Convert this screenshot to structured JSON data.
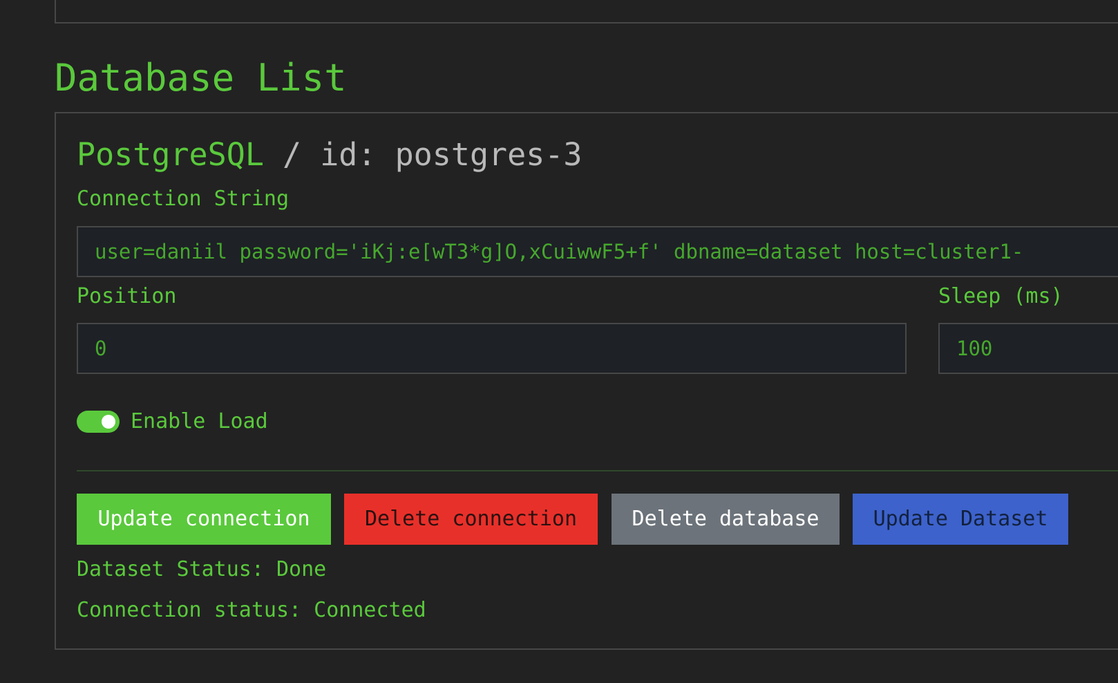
{
  "section": {
    "title": "Database List"
  },
  "card": {
    "db_type": "PostgreSQL",
    "separator": "/",
    "id_label": "id:",
    "id_value": "postgres-3",
    "connection_string": {
      "label": "Connection String",
      "value": "user=daniil password='iKj:e[wT3*g]O,xCuiwwF5+f' dbname=dataset host=cluster1-"
    },
    "position": {
      "label": "Position",
      "value": "0"
    },
    "sleep": {
      "label": "Sleep (ms)",
      "value": "100"
    },
    "enable_load": {
      "label": "Enable Load",
      "enabled": true
    },
    "buttons": {
      "update_connection": "Update connection",
      "delete_connection": "Delete connection",
      "delete_database": "Delete database",
      "update_dataset": "Update Dataset"
    },
    "dataset_status": "Dataset Status: Done",
    "connection_status": "Connection status: Connected"
  },
  "colors": {
    "background": "#222222",
    "accent_green": "#5ac93c",
    "danger_red": "#e8302a",
    "neutral_gray": "#6c737a",
    "primary_blue": "#3d62cb",
    "border": "#474747"
  }
}
